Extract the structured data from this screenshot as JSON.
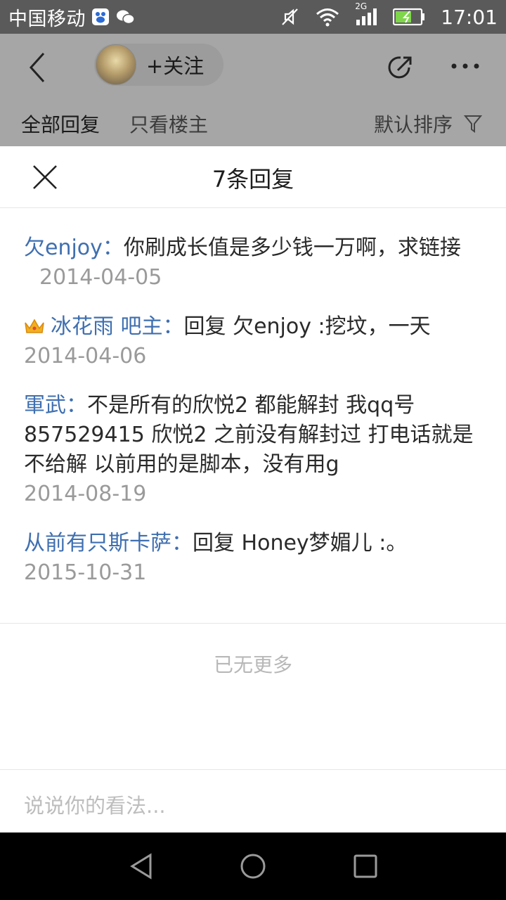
{
  "status_bar": {
    "carrier": "中国移动",
    "network": "2G",
    "time": "17:01",
    "icons": [
      "baidu-icon",
      "wechat-icon",
      "mute-icon",
      "wifi-icon",
      "signal-icon",
      "battery-icon"
    ]
  },
  "header": {
    "follow_label": "+关注",
    "icons": [
      "back-icon",
      "share-icon",
      "more-icon"
    ]
  },
  "tabs": {
    "all": "全部回复",
    "owner_only": "只看楼主",
    "sort": "默认排序"
  },
  "sheet": {
    "title": "7条回复",
    "replies": [
      {
        "user": "欠enjoy：",
        "text": "你刷成长值是多少钱一万啊，求链接",
        "date": "2014-04-05"
      },
      {
        "user": "冰花雨 吧主：",
        "text": "回复 欠enjoy :挖坟，一天",
        "date": "2014-04-06"
      },
      {
        "user": "軍武：",
        "text": "不是所有的欣悦2 都能解封 我qq号857529415 欣悦2 之前没有解封过 打电话就是不给解 以前用的是脚本，没有用g",
        "date": "2014-08-19"
      },
      {
        "user": "从前有只斯卡萨：",
        "text": "回复 Honey梦媚儿 :。",
        "date": "2015-10-31"
      }
    ],
    "no_more": "已无更多",
    "input_placeholder": "说说你的看法..."
  },
  "colors": {
    "username": "#3f6fb0",
    "date": "#9a9a9a",
    "overlay": "#a6a6a6"
  }
}
